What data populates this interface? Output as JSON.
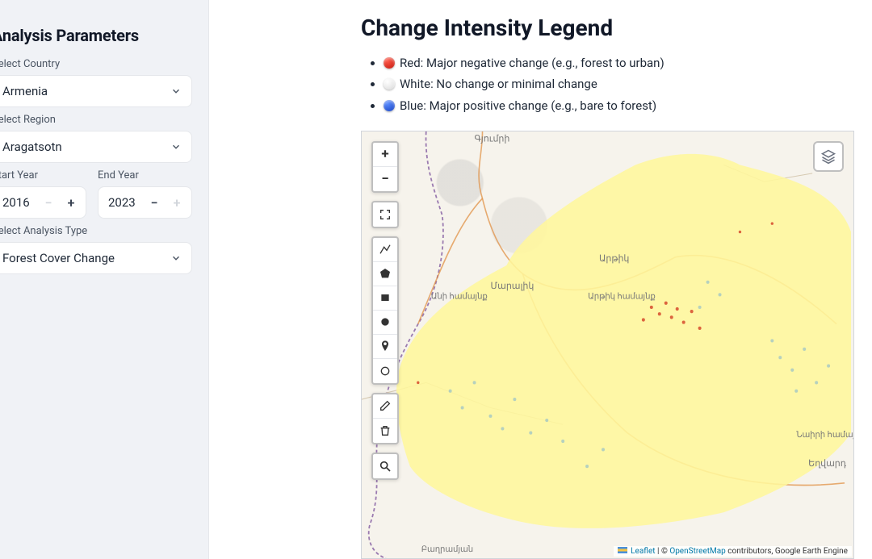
{
  "sidebar": {
    "title": "Analysis Parameters",
    "country_label": "Select Country",
    "country_value": "Armenia",
    "region_label": "Select Region",
    "region_value": "Aragatsotn",
    "start_year_label": "Start Year",
    "start_year_value": "2016",
    "end_year_label": "End Year",
    "end_year_value": "2023",
    "analysis_type_label": "Select Analysis Type",
    "analysis_type_value": "Forest Cover Change"
  },
  "legend": {
    "title": "Change Intensity Legend",
    "items": [
      {
        "color": "red",
        "text": "Red: Major negative change (e.g., forest to urban)"
      },
      {
        "color": "white",
        "text": "White: No change or minimal change"
      },
      {
        "color": "blue",
        "text": "Blue: Major positive change (e.g., bare to forest)"
      }
    ]
  },
  "map": {
    "controls": {
      "zoom_in": "+",
      "zoom_out": "−"
    },
    "places": {
      "gyumri": "Գյումրի",
      "artik": "Արթիկ",
      "maralik": "Մարալիկ",
      "ani": "Անի համայնք",
      "artikham": "Արթիկ համայնք",
      "naiири": "Նաիրի համայնք",
      "yeghvard": "Եղվարդ",
      "baghramyan": "Բաղրամյան"
    },
    "attribution": {
      "leaflet": "Leaflet",
      "sep": " | © ",
      "osm": "OpenStreetMap",
      "tail": " contributors, Google Earth Engine"
    }
  }
}
